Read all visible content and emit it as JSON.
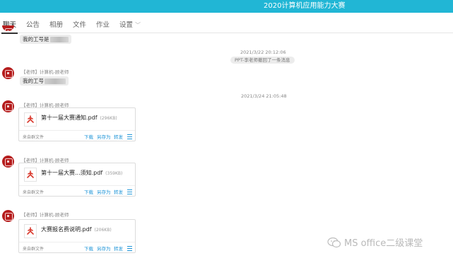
{
  "header": {
    "title": "2020计算机应用能力大赛"
  },
  "tabs": [
    {
      "label": "聊天",
      "active": true
    },
    {
      "label": "公告"
    },
    {
      "label": "相册"
    },
    {
      "label": "文件"
    },
    {
      "label": "作业"
    },
    {
      "label": "设置"
    }
  ],
  "messages": {
    "m1": {
      "text": "我的工号是"
    },
    "stamp1": "2021/3/22 20:12:06",
    "notice1": "PPT-李老师撤回了一条消息",
    "m2": {
      "sender": "【老师】计算机-顾老师",
      "text": "我的工号"
    },
    "stamp2": "2021/3/24 21:05:48",
    "files": [
      {
        "sender": "【老师】计算机-顾老师",
        "name": "第十一届大赛通知.pdf",
        "size": "(296KB)",
        "source": "来自群文件"
      },
      {
        "sender": "【老师】计算机-顾老师",
        "name": "第十一届大赛...须知.pdf",
        "size": "(359KB)",
        "source": "来自群文件"
      },
      {
        "sender": "【老师】计算机-顾老师",
        "name": "大赛报名费说明.pdf",
        "size": "(206KB)",
        "source": "来自群文件"
      }
    ],
    "actions": {
      "download": "下载",
      "save_as": "另存为",
      "forward": "转发"
    }
  },
  "watermark": "MS office二级课堂",
  "colors": {
    "header_bg": "#21b6d5",
    "link": "#2196d8",
    "avatar": "#b51d1d"
  }
}
